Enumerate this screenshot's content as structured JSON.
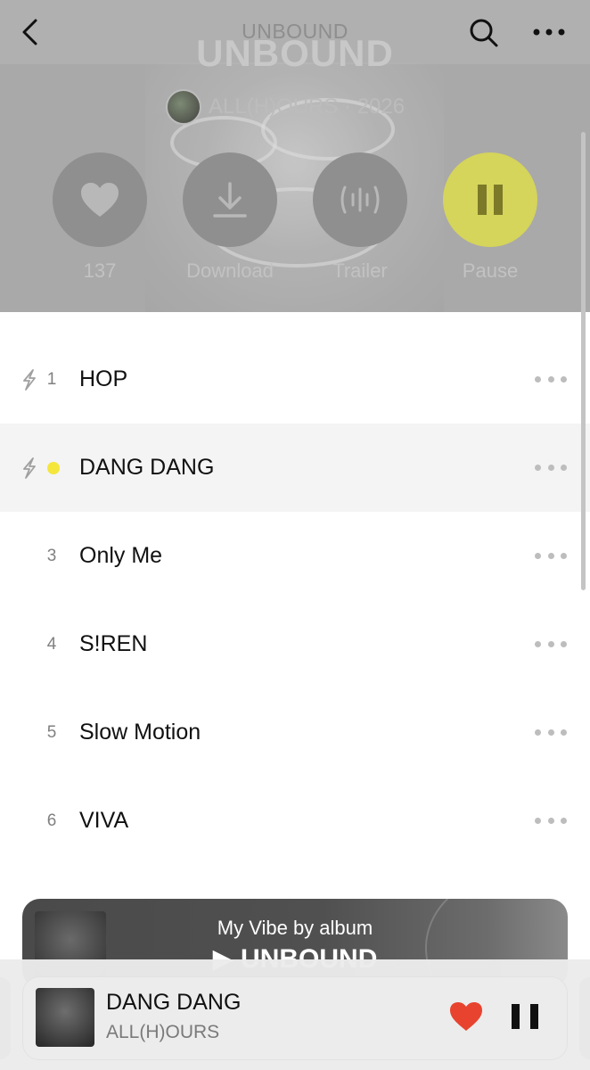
{
  "header": {
    "nav_title": "UNBOUND",
    "hero_title": "UNBOUND",
    "artist_year": "ALL(H)OURS · 2026"
  },
  "actions": [
    {
      "label": "137",
      "icon": "heart-icon"
    },
    {
      "label": "Download",
      "icon": "download-icon"
    },
    {
      "label": "Trailer",
      "icon": "trailer-waveform-icon"
    },
    {
      "label": "Pause",
      "icon": "pause-icon"
    }
  ],
  "tracks": [
    {
      "number": "1",
      "title": "HOP",
      "has_bolt": true,
      "active": false
    },
    {
      "number": "",
      "title": "DANG DANG",
      "has_bolt": true,
      "active": true
    },
    {
      "number": "3",
      "title": "Only Me",
      "has_bolt": false,
      "active": false
    },
    {
      "number": "4",
      "title": "S!REN",
      "has_bolt": false,
      "active": false
    },
    {
      "number": "5",
      "title": "Slow Motion",
      "has_bolt": false,
      "active": false
    },
    {
      "number": "6",
      "title": "VIVA",
      "has_bolt": false,
      "active": false
    }
  ],
  "vibe": {
    "title": "My Vibe by album",
    "subtitle": "▶ UNBOUND"
  },
  "mini_player": {
    "song": "DANG DANG",
    "artist": "ALL(H)OURS",
    "liked": true
  },
  "colors": {
    "accent_yellow": "#f5e63c",
    "pause_button": "#d5d45b",
    "heart_red": "#e8432f",
    "hero_bg": "#a9a9a9"
  }
}
